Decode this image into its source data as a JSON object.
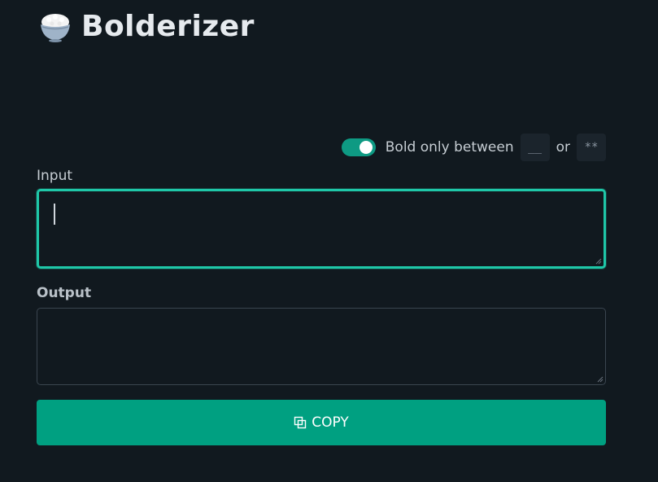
{
  "app": {
    "title": "Bolderizer",
    "icon": "rice-bowl-icon"
  },
  "options": {
    "toggle_on": true,
    "toggle_label": "Bold only between",
    "delimiter_underscore": "__",
    "or_text": "or",
    "delimiter_asterisk": "**"
  },
  "input": {
    "label": "Input",
    "value": ""
  },
  "output": {
    "label": "Output",
    "value": ""
  },
  "copy_button": {
    "label": "COPY",
    "icon": "copy-icon"
  },
  "colors": {
    "background": "#11191f",
    "accent": "#00a081",
    "focus_border": "#1fc7a8"
  }
}
